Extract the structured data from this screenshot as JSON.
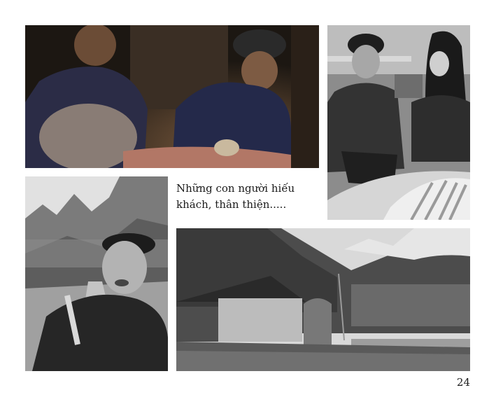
{
  "caption": {
    "line1": "Những con người hiếu",
    "line2": "khách, thân thiện....."
  },
  "page": {
    "number": "24"
  },
  "photos": [
    {
      "id": "photo-men-eating",
      "tone": "color-dark"
    },
    {
      "id": "photo-market-women",
      "tone": "grayscale"
    },
    {
      "id": "photo-old-man-portrait",
      "tone": "grayscale"
    },
    {
      "id": "photo-village-house",
      "tone": "grayscale"
    }
  ]
}
